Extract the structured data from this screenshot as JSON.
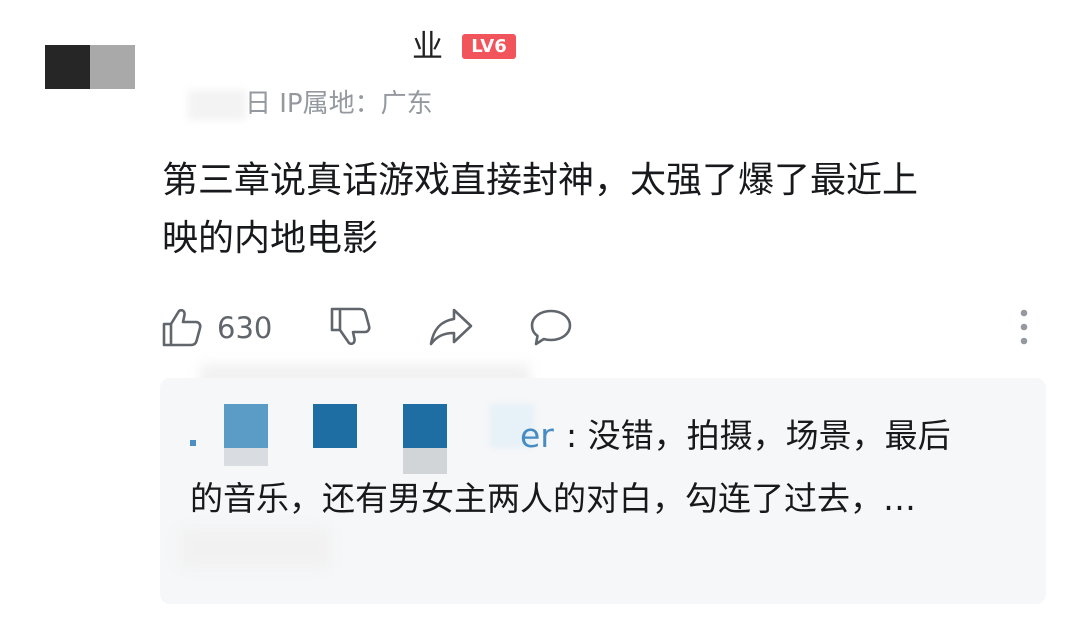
{
  "comment": {
    "username": "业",
    "level_badge": "LV6",
    "meta": "日 IP属地：广东",
    "content": "第三章说真话游戏直接封神，太强了爆了最近上映的内地电影",
    "content_line1": "第三章说真话游戏直接封神，太强了爆了最近上",
    "content_line2": "映的内地电影",
    "like_count": "630"
  },
  "icons": {
    "like": "thumbs-up-icon",
    "dislike": "thumbs-down-icon",
    "share": "share-icon",
    "reply": "comment-bubble-icon",
    "more": "more-vertical-icon"
  },
  "reply": {
    "username_suffix": "er",
    "line1_text": ": 没错，拍摄，场景，最后",
    "line2_text": "的音乐，还有男女主两人的对白，勾连了过去，…"
  },
  "colors": {
    "level_badge": "#f2545b",
    "reply_username": "#2a7ab8",
    "meta_text": "#9499a0",
    "reply_bg": "#f6f7f8"
  }
}
